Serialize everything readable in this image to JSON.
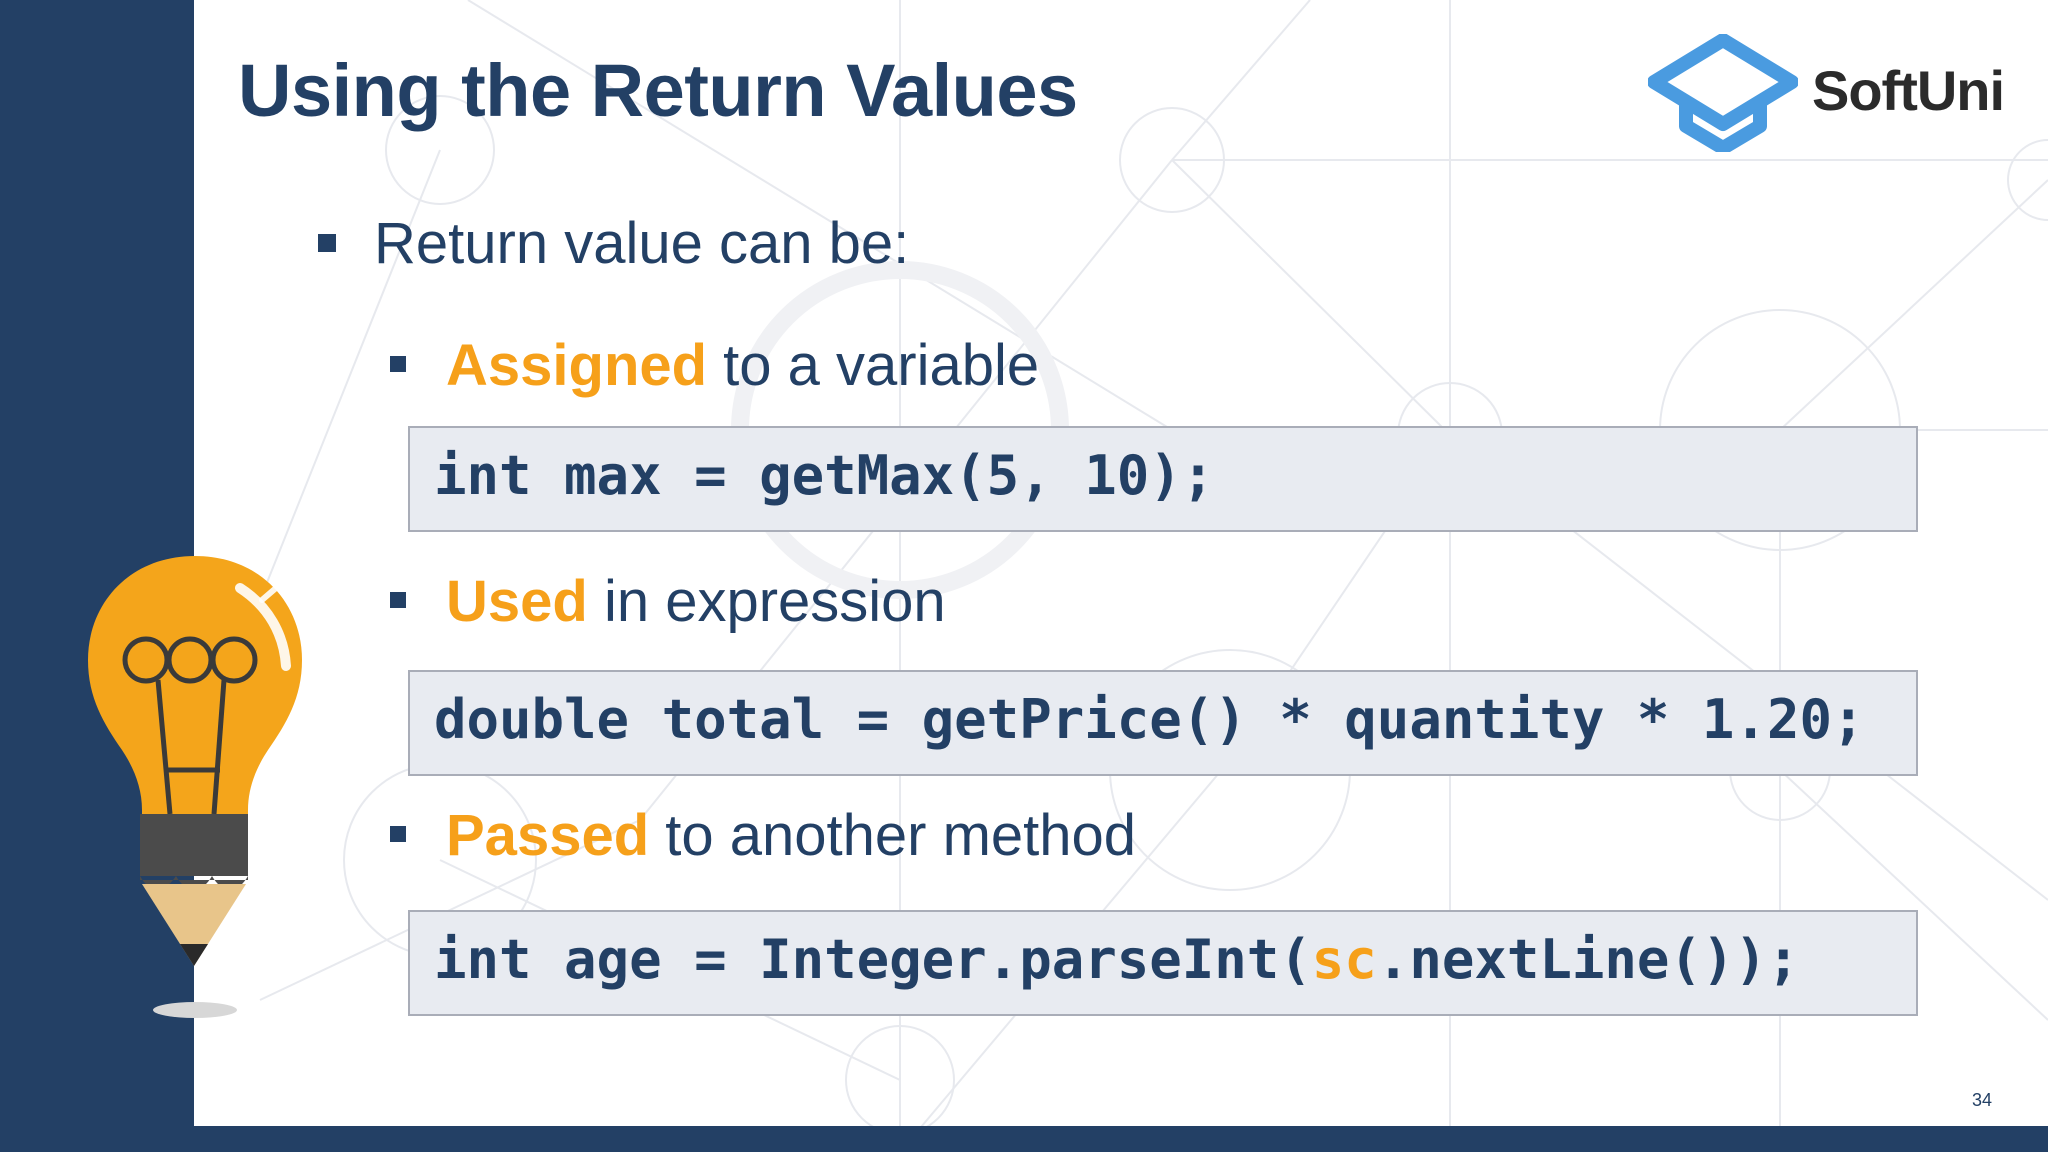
{
  "title": "Using the Return Values",
  "logo": {
    "text": "SoftUni",
    "icon": "graduation-cap-icon",
    "color": "#4a9be0"
  },
  "bullets": {
    "main": "Return value can be:",
    "items": [
      {
        "highlight": "Assigned",
        "rest": " to a variable",
        "code": "int max = getMax(5, 10);"
      },
      {
        "highlight": "Used",
        "rest": " in expression",
        "code": "double total = getPrice() * quantity * 1.20;"
      },
      {
        "highlight": "Passed",
        "rest": " to another method",
        "code_before": "int age = Integer.parseInt(",
        "code_accent": "sc",
        "code_after": ".nextLine());"
      }
    ]
  },
  "page_number": "34",
  "illustration": "lightbulb-pencil-icon",
  "colors": {
    "navy": "#234065",
    "accent": "#f6a01a",
    "code_bg": "#e8ebf1"
  }
}
